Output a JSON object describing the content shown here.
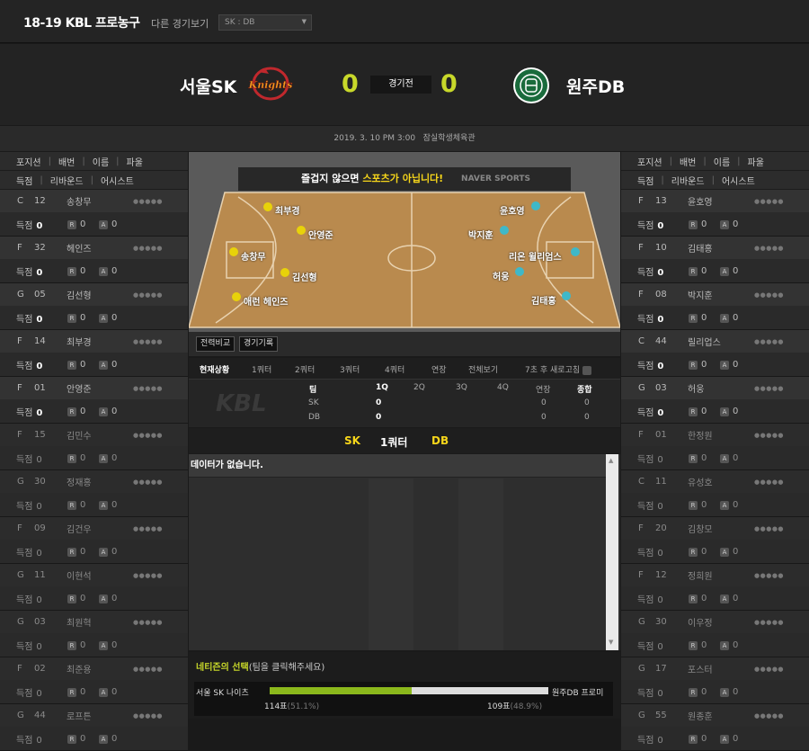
{
  "header": {
    "league": "18-19 KBL 프로농구",
    "other_games_label": "다른 경기보기",
    "game_select": "SK : DB"
  },
  "game": {
    "home_team": "서울SK",
    "away_team": "원주DB",
    "home_score": "0",
    "away_score": "0",
    "status": "경기전",
    "home_logo_text": "Knights",
    "datetime": "2019. 3. 10 PM 3:00",
    "venue": "잠실학생체육관"
  },
  "columns": {
    "pos": "포지션",
    "num": "배번",
    "name": "이름",
    "fouls": "파울",
    "pts": "득점",
    "reb": "리바운드",
    "ast": "어시스트"
  },
  "stat_labels": {
    "pts": "득점",
    "reb_badge": "R",
    "ast_badge": "A"
  },
  "left_players": [
    {
      "pos": "C",
      "num": "12",
      "name": "송창무",
      "pts": "0",
      "reb": "0",
      "ast": "0",
      "dots": "●●●●●"
    },
    {
      "pos": "F",
      "num": "32",
      "name": "헤인즈",
      "pts": "0",
      "reb": "0",
      "ast": "0",
      "dots": "●●●●●"
    },
    {
      "pos": "G",
      "num": "05",
      "name": "김선형",
      "pts": "0",
      "reb": "0",
      "ast": "0",
      "dots": "●●●●●"
    },
    {
      "pos": "F",
      "num": "14",
      "name": "최부경",
      "pts": "0",
      "reb": "0",
      "ast": "0",
      "dots": "●●●●●"
    },
    {
      "pos": "F",
      "num": "01",
      "name": "안영준",
      "pts": "0",
      "reb": "0",
      "ast": "0",
      "dots": "●●●●●"
    },
    {
      "pos": "F",
      "num": "15",
      "name": "김민수",
      "pts": "0",
      "reb": "0",
      "ast": "0",
      "dots": "●●●●●"
    },
    {
      "pos": "G",
      "num": "30",
      "name": "정재홍",
      "pts": "0",
      "reb": "0",
      "ast": "0",
      "dots": "●●●●●"
    },
    {
      "pos": "F",
      "num": "09",
      "name": "김건우",
      "pts": "0",
      "reb": "0",
      "ast": "0",
      "dots": "●●●●●"
    },
    {
      "pos": "G",
      "num": "11",
      "name": "이현석",
      "pts": "0",
      "reb": "0",
      "ast": "0",
      "dots": "●●●●●"
    },
    {
      "pos": "G",
      "num": "03",
      "name": "최원혁",
      "pts": "0",
      "reb": "0",
      "ast": "0",
      "dots": "●●●●●"
    },
    {
      "pos": "F",
      "num": "02",
      "name": "최준용",
      "pts": "0",
      "reb": "0",
      "ast": "0",
      "dots": "●●●●●"
    },
    {
      "pos": "G",
      "num": "44",
      "name": "로프튼",
      "pts": "0",
      "reb": "0",
      "ast": "0",
      "dots": "●●●●●"
    }
  ],
  "right_players": [
    {
      "pos": "F",
      "num": "13",
      "name": "윤호영",
      "pts": "0",
      "reb": "0",
      "ast": "0",
      "dots": "●●●●●"
    },
    {
      "pos": "F",
      "num": "10",
      "name": "김태홍",
      "pts": "0",
      "reb": "0",
      "ast": "0",
      "dots": "●●●●●"
    },
    {
      "pos": "F",
      "num": "08",
      "name": "박지훈",
      "pts": "0",
      "reb": "0",
      "ast": "0",
      "dots": "●●●●●"
    },
    {
      "pos": "C",
      "num": "44",
      "name": "릴리업스",
      "pts": "0",
      "reb": "0",
      "ast": "0",
      "dots": "●●●●●"
    },
    {
      "pos": "G",
      "num": "03",
      "name": "허웅",
      "pts": "0",
      "reb": "0",
      "ast": "0",
      "dots": "●●●●●"
    },
    {
      "pos": "F",
      "num": "01",
      "name": "한정원",
      "pts": "0",
      "reb": "0",
      "ast": "0",
      "dots": "●●●●●"
    },
    {
      "pos": "C",
      "num": "11",
      "name": "유성호",
      "pts": "0",
      "reb": "0",
      "ast": "0",
      "dots": "●●●●●"
    },
    {
      "pos": "F",
      "num": "20",
      "name": "김창모",
      "pts": "0",
      "reb": "0",
      "ast": "0",
      "dots": "●●●●●"
    },
    {
      "pos": "F",
      "num": "12",
      "name": "정희원",
      "pts": "0",
      "reb": "0",
      "ast": "0",
      "dots": "●●●●●"
    },
    {
      "pos": "G",
      "num": "30",
      "name": "이우정",
      "pts": "0",
      "reb": "0",
      "ast": "0",
      "dots": "●●●●●"
    },
    {
      "pos": "G",
      "num": "17",
      "name": "포스터",
      "pts": "0",
      "reb": "0",
      "ast": "0",
      "dots": "●●●●●"
    },
    {
      "pos": "G",
      "num": "55",
      "name": "원종훈",
      "pts": "0",
      "reb": "0",
      "ast": "0",
      "dots": "●●●●●"
    }
  ],
  "court": {
    "banner_pre": "즐겁지 않으면 ",
    "banner_hi": "스포츠가 아닙니다!",
    "banner_brand": "NAVER SPORTS",
    "home_color": "#e8d20a",
    "away_color": "#3fb8c8",
    "home_markers": [
      "최부경",
      "안영준",
      "송창무",
      "김선형",
      "애런 헤인즈"
    ],
    "away_markers": [
      "윤호영",
      "박지훈",
      "리온 윌리엄스",
      "허웅",
      "김태홍"
    ]
  },
  "court_tabs": [
    "전력비교",
    "경기기록"
  ],
  "quarter_tabs": [
    "현재상황",
    "1쿼터",
    "2쿼터",
    "3쿼터",
    "4쿼터",
    "연장",
    "전체보기"
  ],
  "refresh_text": "7초 후 새로고침",
  "quarter_table": {
    "headers": [
      "팀",
      "1Q",
      "2Q",
      "3Q",
      "4Q",
      "연장",
      "종합"
    ],
    "rows": [
      {
        "team": "SK",
        "q1": "0",
        "ot": "0",
        "total": "0"
      },
      {
        "team": "DB",
        "q1": "0",
        "ot": "0",
        "total": "0"
      }
    ]
  },
  "current_quarter": {
    "home": "SK",
    "label": "1쿼터",
    "away": "DB"
  },
  "log": {
    "no_data": "데이터가 없습니다."
  },
  "vote": {
    "title_hi": "네티즌의 선택",
    "title_rest": "(팀을 클릭해주세요)",
    "home_team": "서울 SK 나이츠",
    "away_team": "원주DB 프로미",
    "home_votes": "114표",
    "home_pct": "(51.1%)",
    "away_votes": "109표",
    "away_pct": "(48.9%)",
    "home_share": 0.511
  }
}
